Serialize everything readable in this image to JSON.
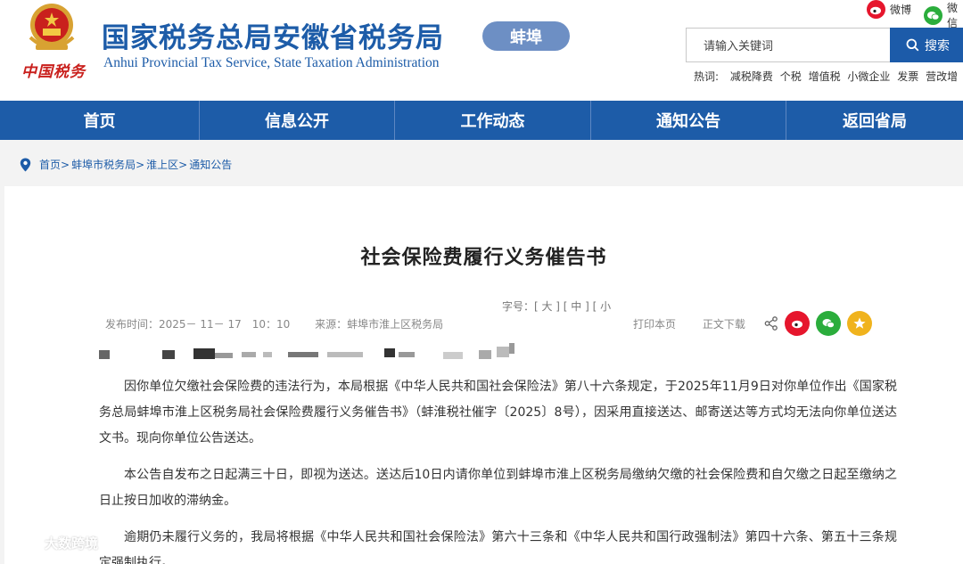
{
  "header": {
    "seal_text": "中国税务",
    "title": "国家税务总局安徽省税务局",
    "subtitle": "Anhui Provincial Tax Service, State Taxation Administration",
    "city": "蚌埠",
    "weibo_label": "微博",
    "weixin_label": "微信"
  },
  "search": {
    "placeholder": "请输入关键词",
    "button": "搜索",
    "hot_label": "热词:",
    "hot_words": [
      "减税降费",
      "个税",
      "增值税",
      "小微企业",
      "发票",
      "营改增"
    ]
  },
  "nav": [
    "首页",
    "信息公开",
    "工作动态",
    "通知公告",
    "返回省局"
  ],
  "breadcrumb": [
    "首页",
    "蚌埠市税务局",
    "淮上区",
    "通知公告"
  ],
  "article": {
    "title": "社会保险费履行义务催告书",
    "font_size_label": "字号：[ 大 ] [ 中 ] [ 小",
    "publish_time": "发布时间：2025－ 11－ 17　10：10",
    "source": "来源：蚌埠市淮上区税务局",
    "print": "打印本页",
    "download": "正文下载",
    "paragraphs": [
      "因你单位欠缴社会保险费的违法行为，本局根据《中华人民共和国社会保险法》第八十六条规定，于2025年11月9日对你单位作出《国家税务总局蚌埠市淮上区税务局社会保险费履行义务催告书》（蚌淮税社催字〔2025〕8号），因采用直接送达、邮寄送达等方式均无法向你单位送达文书。现向你单位公告送达。",
      "本公告自发布之日起满三十日，即视为送达。送达后10日内请你单位到蚌埠市淮上区税务局缴纳欠缴的社会保险费和自欠缴之日起至缴纳之日止按日加收的滞纳金。",
      "逾期仍未履行义务的，我局将根据《中华人民共和国社会保险法》第六十三条和《中华人民共和国行政强制法》第四十六条、第五十三条规定强制执行。"
    ]
  },
  "watermark": "大数跨境",
  "colors": {
    "brand_blue": "#1d5ca8",
    "city_badge": "#6d8fc4",
    "seal_red": "#c9201d"
  }
}
